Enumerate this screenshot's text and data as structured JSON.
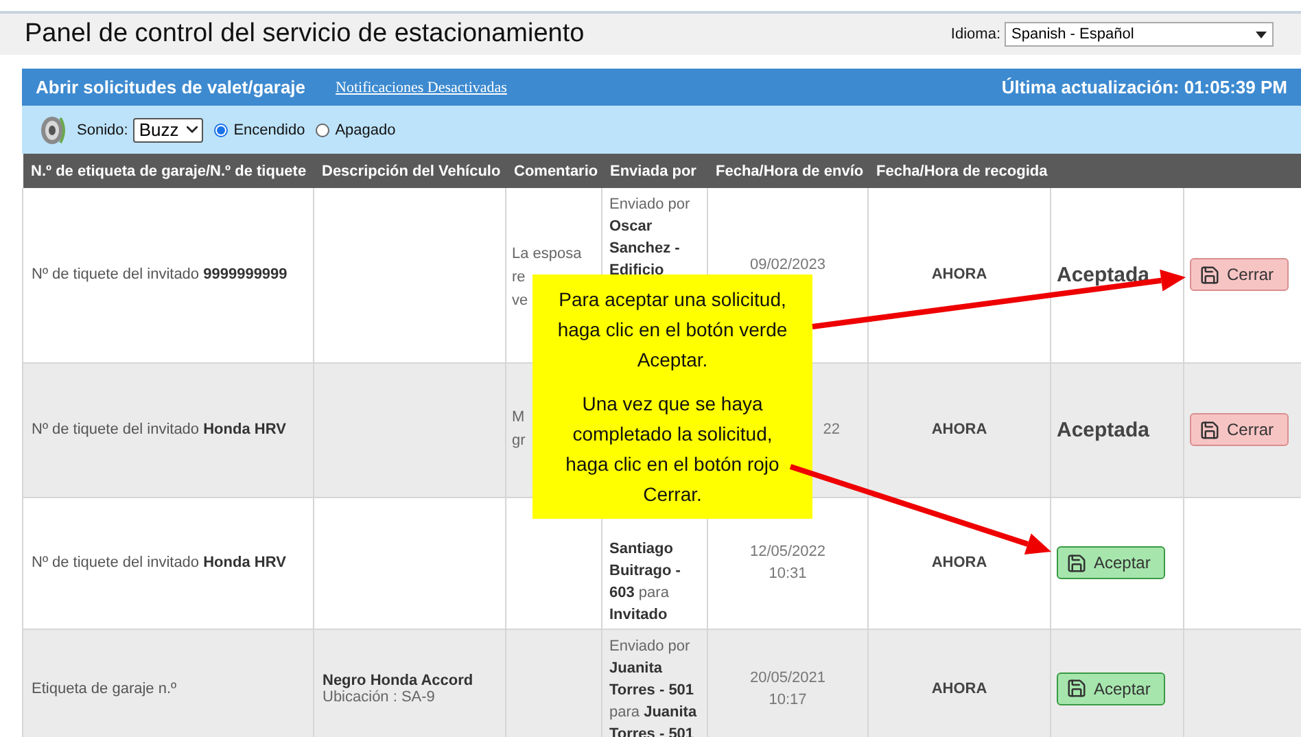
{
  "header": {
    "title": "Panel de control del servicio de estacionamiento",
    "language_label": "Idioma:",
    "language": "Spanish - Español"
  },
  "panel": {
    "title": "Abrir solicitudes de valet/garaje",
    "notifications_link": "Notificaciones Desactivadas",
    "last_update": "Última actualización: 01:05:39 PM"
  },
  "sound": {
    "label": "Sonido:",
    "value": "Buzz",
    "options": [
      {
        "label": "Encendido",
        "selected": true
      },
      {
        "label": "Apagado",
        "selected": false
      }
    ]
  },
  "table": {
    "columns": [
      "N.º de etiqueta de garaje/N.º de tiquete",
      "Descripción del Vehículo",
      "Comentario",
      "Enviada por",
      "Fecha/Hora de envío",
      "Fecha/Hora de recogida"
    ],
    "rows": [
      {
        "ticket": "Nº de tiquete del invitado **9999999999**",
        "comment": [
          "La esposa",
          "re",
          "ve"
        ],
        "sent_by": "Enviado por **Oscar Sanchez - Edificio**",
        "sent_at": "09/02/2023",
        "pickup": "AHORA",
        "status": "Aceptada",
        "button": {
          "kind": "close",
          "label": "Cerrar"
        }
      },
      {
        "ticket": "Nº de tiquete del invitado **Honda HRV**",
        "comment": [
          "M",
          "gr"
        ],
        "sent_at": "22",
        "pickup": "AHORA",
        "status": "Aceptada",
        "button": {
          "kind": "close",
          "label": "Cerrar"
        }
      },
      {
        "ticket": "Nº de tiquete del invitado **Honda HRV**",
        "sent_by": "**Santiago Buitrago - 603** para **Invitado**",
        "sent_at": "12/05/2022 10:31",
        "pickup": "AHORA",
        "button": {
          "kind": "accept",
          "label": "Aceptar"
        }
      },
      {
        "ticket": "Etiqueta de garaje n.º",
        "vehicle": {
          "name": "Negro Honda Accord",
          "location": "Ubicación : SA-9"
        },
        "sent_by": "Enviado por **Juanita Torres - 501** para **Juanita Torres - 501**",
        "sent_at": "20/05/2021 10:17",
        "pickup": "AHORA",
        "button": {
          "kind": "accept",
          "label": "Aceptar"
        }
      }
    ]
  },
  "callout": {
    "paragraphs": [
      "Para aceptar una solicitud, haga clic en el botón verde Aceptar.",
      "Una vez que se haya completado la solicitud, haga clic en el botón rojo Cerrar."
    ]
  }
}
